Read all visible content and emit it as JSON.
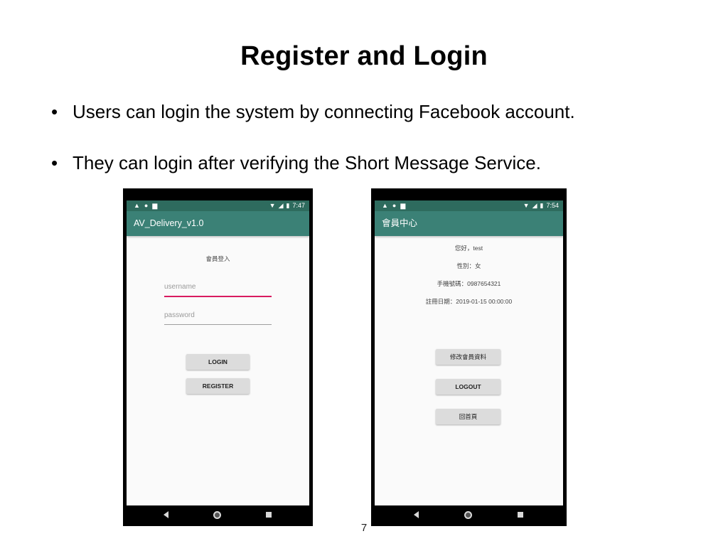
{
  "slide": {
    "title": "Register and Login",
    "bullets": [
      "Users can login the system by connecting Facebook account.",
      "They can login after verifying the Short Message Service."
    ],
    "page_number": "7"
  },
  "login_screen": {
    "status": {
      "time": "7:47",
      "left_icons": [
        "warning-icon",
        "circle-icon",
        "sd-card-icon"
      ],
      "right_icons": [
        "wifi-icon",
        "signal-icon",
        "battery-icon"
      ]
    },
    "app_title": "AV_Delivery_v1.0",
    "heading": "會員登入",
    "username_placeholder": "username",
    "password_placeholder": "password",
    "login_label": "LOGIN",
    "register_label": "REGISTER"
  },
  "member_screen": {
    "status": {
      "time": "7:54",
      "left_icons": [
        "warning-icon",
        "circle-icon",
        "sd-card-icon"
      ],
      "right_icons": [
        "wifi-icon",
        "signal-icon",
        "battery-icon"
      ]
    },
    "app_title": "會員中心",
    "greeting": "您好，test",
    "gender": "性別：女",
    "phone": "手機號碼：0987654321",
    "register_date": "註冊日期：2019-01-15 00:00:00",
    "edit_label": "修改會員資料",
    "logout_label": "LOGOUT",
    "home_label": "回首頁"
  },
  "colors": {
    "status_bar": "#2e6b5e",
    "app_bar": "#3b8176",
    "accent": "#d81b60"
  }
}
